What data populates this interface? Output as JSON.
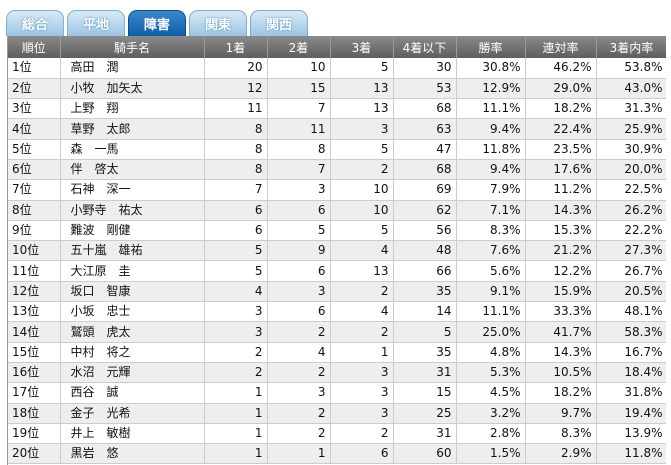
{
  "tabs": [
    {
      "label": "総合",
      "active": false
    },
    {
      "label": "平地",
      "active": false
    },
    {
      "label": "障害",
      "active": true
    },
    {
      "label": "関東",
      "active": false
    },
    {
      "label": "関西",
      "active": false
    }
  ],
  "table": {
    "headers": [
      "順位",
      "騎手名",
      "1着",
      "2着",
      "3着",
      "4着以下",
      "勝率",
      "連対率",
      "3着内率"
    ],
    "rows": [
      [
        "1位",
        "高田　潤",
        "20",
        "10",
        "5",
        "30",
        "30.8%",
        "46.2%",
        "53.8%"
      ],
      [
        "2位",
        "小牧　加矢太",
        "12",
        "15",
        "13",
        "53",
        "12.9%",
        "29.0%",
        "43.0%"
      ],
      [
        "3位",
        "上野　翔",
        "11",
        "7",
        "13",
        "68",
        "11.1%",
        "18.2%",
        "31.3%"
      ],
      [
        "4位",
        "草野　太郎",
        "8",
        "11",
        "3",
        "63",
        "9.4%",
        "22.4%",
        "25.9%"
      ],
      [
        "5位",
        "森　一馬",
        "8",
        "8",
        "5",
        "47",
        "11.8%",
        "23.5%",
        "30.9%"
      ],
      [
        "6位",
        "伴　啓太",
        "8",
        "7",
        "2",
        "68",
        "9.4%",
        "17.6%",
        "20.0%"
      ],
      [
        "7位",
        "石神　深一",
        "7",
        "3",
        "10",
        "69",
        "7.9%",
        "11.2%",
        "22.5%"
      ],
      [
        "8位",
        "小野寺　祐太",
        "6",
        "6",
        "10",
        "62",
        "7.1%",
        "14.3%",
        "26.2%"
      ],
      [
        "9位",
        "難波　剛健",
        "6",
        "5",
        "5",
        "56",
        "8.3%",
        "15.3%",
        "22.2%"
      ],
      [
        "10位",
        "五十嵐　雄祐",
        "5",
        "9",
        "4",
        "48",
        "7.6%",
        "21.2%",
        "27.3%"
      ],
      [
        "11位",
        "大江原　圭",
        "5",
        "6",
        "13",
        "66",
        "5.6%",
        "12.2%",
        "26.7%"
      ],
      [
        "12位",
        "坂口　智康",
        "4",
        "3",
        "2",
        "35",
        "9.1%",
        "15.9%",
        "20.5%"
      ],
      [
        "13位",
        "小坂　忠士",
        "3",
        "6",
        "4",
        "14",
        "11.1%",
        "33.3%",
        "48.1%"
      ],
      [
        "14位",
        "鷲頭　虎太",
        "3",
        "2",
        "2",
        "5",
        "25.0%",
        "41.7%",
        "58.3%"
      ],
      [
        "15位",
        "中村　将之",
        "2",
        "4",
        "1",
        "35",
        "4.8%",
        "14.3%",
        "16.7%"
      ],
      [
        "16位",
        "水沼　元輝",
        "2",
        "2",
        "3",
        "31",
        "5.3%",
        "10.5%",
        "18.4%"
      ],
      [
        "17位",
        "西谷　誠",
        "1",
        "3",
        "3",
        "15",
        "4.5%",
        "18.2%",
        "31.8%"
      ],
      [
        "18位",
        "金子　光希",
        "1",
        "2",
        "3",
        "25",
        "3.2%",
        "9.7%",
        "19.4%"
      ],
      [
        "19位",
        "井上　敏樹",
        "1",
        "2",
        "2",
        "31",
        "2.8%",
        "8.3%",
        "13.9%"
      ],
      [
        "20位",
        "黒岩　悠",
        "1",
        "1",
        "6",
        "60",
        "1.5%",
        "2.9%",
        "11.8%"
      ]
    ]
  }
}
